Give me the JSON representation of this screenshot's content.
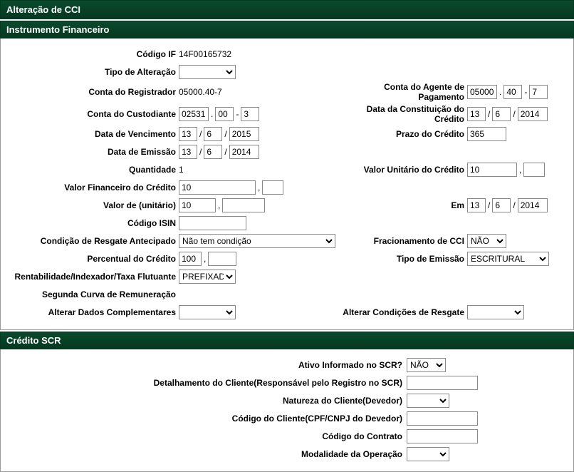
{
  "page_title": "Alteração de CCI",
  "section1": "Instrumento Financeiro",
  "section2": "Crédito SCR",
  "labels": {
    "codigo_if": "Código IF",
    "tipo_alteracao": "Tipo de Alteração",
    "conta_registrador": "Conta do Registrador",
    "conta_custodiante": "Conta do Custodiante",
    "data_vencimento": "Data de Vencimento",
    "data_emissao": "Data de Emissão",
    "quantidade": "Quantidade",
    "valor_fin_credito": "Valor Financeiro do Crédito",
    "valor_unitario": "Valor de (unitário)",
    "codigo_isin": "Código ISIN",
    "cond_resgate": "Condição de Resgate Antecipado",
    "percentual_credito": "Percentual do Crédito",
    "rentabilidade": "Rentabilidade/Indexador/Taxa Flutuante",
    "segunda_curva": "Segunda Curva de Remuneração",
    "alterar_dados": "Alterar Dados Complementares",
    "conta_agente": "Conta do Agente de Pagamento",
    "data_constituicao": "Data da Constituição do Crédito",
    "prazo_credito": "Prazo do Crédito",
    "valor_unit_credito": "Valor Unitário do Crédito",
    "em": "Em",
    "fracionamento": "Fracionamento de CCI",
    "tipo_emissao": "Tipo de Emissão",
    "alterar_cond": "Alterar Condições de Resgate",
    "ativo_scr": "Ativo Informado no SCR?",
    "detalhamento": "Detalhamento do Cliente(Responsável pelo Registro no SCR)",
    "natureza": "Natureza do Cliente(Devedor)",
    "codigo_cliente": "Código do Cliente(CPF/CNPJ do Devedor)",
    "codigo_contrato": "Código do Contrato",
    "modalidade": "Modalidade da Operação"
  },
  "values": {
    "codigo_if": "14F00165732",
    "conta_registrador": "05000.40-7",
    "quantidade": "1",
    "conta_custodiante_1": "02531",
    "conta_custodiante_2": "00",
    "conta_custodiante_3": "3",
    "data_vencimento_d": "13",
    "data_vencimento_m": "6",
    "data_vencimento_y": "2015",
    "data_emissao_d": "13",
    "data_emissao_m": "6",
    "data_emissao_y": "2014",
    "valor_fin_credito_int": "10",
    "valor_fin_credito_dec": "",
    "valor_unitario_int": "10",
    "valor_unitario_dec": "",
    "codigo_isin": "",
    "cond_resgate": "Não tem condição",
    "percentual_credito_int": "100",
    "percentual_credito_dec": "",
    "rentabilidade": "PREFIXADO",
    "conta_agente_1": "05000",
    "conta_agente_2": "40",
    "conta_agente_3": "7",
    "data_const_d": "13",
    "data_const_m": "6",
    "data_const_y": "2014",
    "prazo_credito": "365",
    "valor_unit_cred_int": "10",
    "valor_unit_cred_dec": "",
    "em_d": "13",
    "em_m": "6",
    "em_y": "2014",
    "fracionamento": "NÃO",
    "tipo_emissao": "ESCRITURAL",
    "ativo_scr": "NÃO",
    "detalhamento": "",
    "codigo_cliente": "",
    "codigo_contrato": ""
  }
}
